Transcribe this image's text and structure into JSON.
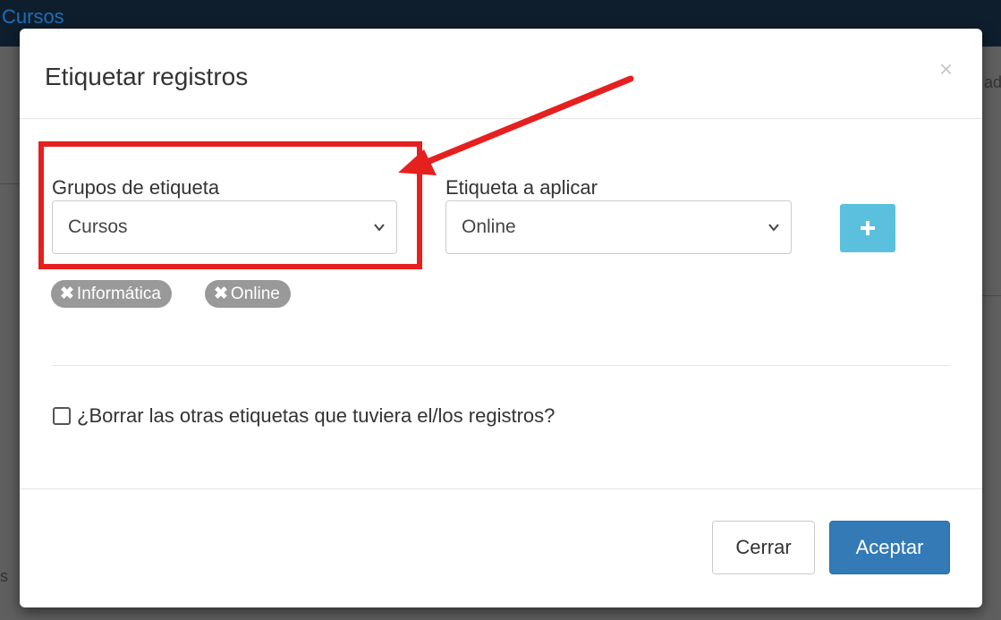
{
  "background": {
    "title": "Cursos",
    "fragment_right": "ad",
    "fragment_bottom": "s"
  },
  "modal": {
    "title": "Etiquetar registros",
    "close_symbol": "×",
    "group_label": "Grupos de etiqueta",
    "group_value": "Cursos",
    "tag_label": "Etiqueta a aplicar",
    "tag_value": "Online",
    "add_symbol": "+",
    "tags": [
      {
        "symbol": "✖",
        "label": "Informática"
      },
      {
        "symbol": "✖",
        "label": "Online"
      }
    ],
    "checkbox_label": "¿Borrar las otras etiquetas que tuviera el/los registros?",
    "checkbox_checked": false,
    "close_button": "Cerrar",
    "accept_button": "Aceptar"
  },
  "colors": {
    "primary": "#337ab7",
    "info": "#5bc0de",
    "annotation": "#e5201f",
    "tag_bg": "#999999"
  }
}
